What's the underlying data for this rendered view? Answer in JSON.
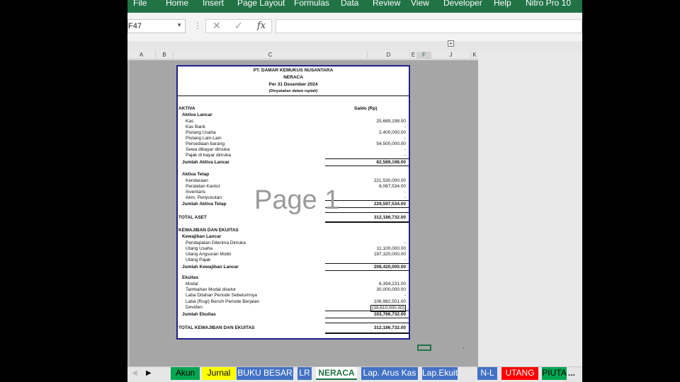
{
  "ribbon": {
    "menu": [
      "File",
      "Home",
      "Insert",
      "Page Layout",
      "Formulas",
      "Data",
      "Review",
      "View",
      "Developer",
      "Help",
      "Nitro Pro 10"
    ]
  },
  "formula_bar": {
    "name_box": "F47",
    "dots": "⋮",
    "cancel": "✕",
    "enter": "✓",
    "fx": "fx",
    "content": ""
  },
  "columns": [
    "A",
    "B",
    "C",
    "D",
    "E",
    "F",
    "J",
    "K"
  ],
  "selected_column": "F",
  "report": {
    "company": "PT. DAMAR KEMUKUS NUSANTARA",
    "title": "NERACA",
    "period": "Per 31 Desember 2024",
    "note": "(Dinyatakan dalam rupiah)",
    "aktiva_header": "AKTIVA",
    "saldo_header": "Saldo (Rp)",
    "aktiva_lancar": {
      "header": "Aktiva Lancar",
      "items": [
        {
          "label": "Kas",
          "amount": "25,689,198.00"
        },
        {
          "label": "Kas Bank",
          "amount": "-"
        },
        {
          "label": "Piutang Usaha",
          "amount": "2,400,000.00"
        },
        {
          "label": "Piutang Lain-Lain",
          "amount": "-"
        },
        {
          "label": "Persediaan barang",
          "amount": "54,500,000.00"
        },
        {
          "label": "Sewa dibayar dimuka",
          "amount": "-"
        },
        {
          "label": "Pajak di bayar dimuka",
          "amount": "-"
        }
      ],
      "total_label": "Jumlah Aktiva Lancar",
      "total": "82,589,198.00"
    },
    "aktiva_tetap": {
      "header": "Aktiva Tetap",
      "items": [
        {
          "label": "Kendaraan",
          "amount": "221,530,000.00"
        },
        {
          "label": "Peralatan Kantor",
          "amount": "8,067,534.00"
        },
        {
          "label": "Inventaris",
          "amount": "-"
        },
        {
          "label": "Akm. Penyusutan",
          "amount": "-"
        }
      ],
      "total_label": "Jumlah Aktiva Tetap",
      "total": "229,597,534.00"
    },
    "total_aset_label": "TOTAL ASET",
    "total_aset": "312,186,732.00",
    "kewajiban_ekuitas_header": "KEWAJIBAN DAN EKUITAS",
    "kewajiban_lancar": {
      "header": "Kewajiban Lancar",
      "items": [
        {
          "label": "Pendapatan Diterima Dimuka",
          "amount": "-"
        },
        {
          "label": "Utang Usaha",
          "amount": "11,100,000.00"
        },
        {
          "label": "Utang Angsuran Mobil",
          "amount": "197,320,000.00"
        },
        {
          "label": "Utang Pajak",
          "amount": "-"
        }
      ],
      "total_label": "Jumlah Kewajiban Lancar",
      "total": "208,420,000.00"
    },
    "ekuitas": {
      "header": "Ekuitas",
      "items": [
        {
          "label": "Modal",
          "amount": "6,394,231.00"
        },
        {
          "label": "Tambahan Modal disetor",
          "amount": "30,000,000.00"
        },
        {
          "label": "Laba Ditahan Periode Sebelumnya",
          "amount": "-"
        },
        {
          "label": "Laba (Rugi) Bersih Periode Berjalan",
          "amount": "106,982,501.00"
        },
        {
          "label": "Deviden",
          "amount": "(39,610,000.00)"
        }
      ],
      "total_label": "Jumlah Ekuitas",
      "total": "103,766,732.00"
    },
    "total_ke_label": "TOTAL KEWAJIBAN DAN EKUITAS",
    "total_ke": "312,186,732.00"
  },
  "watermark": "Page 1",
  "stray_text": "-",
  "sheet_tabs": [
    {
      "label": "Akun",
      "color": "#00a651",
      "text": "#000000"
    },
    {
      "label": "Jurnal",
      "color": "#ffff00",
      "text": "#000000"
    },
    {
      "label": "BUKU BESAR",
      "color": "#4472c4",
      "text": "#ffffff"
    },
    {
      "label": "LR",
      "color": "#4472c4",
      "text": "#ffffff"
    },
    {
      "label": "NERACA",
      "color": "#ffffff",
      "text": "#217346",
      "active": true
    },
    {
      "label": "Lap. Arus Kas",
      "color": "#4472c4",
      "text": "#ffffff"
    },
    {
      "label": "Lap.Ekuitas",
      "color": "#4472c4",
      "text": "#ffffff"
    },
    {
      "label": "N-L",
      "color": "#4472c4",
      "text": "#ffffff"
    },
    {
      "label": "UTANG",
      "color": "#ff0000",
      "text": "#ffffff"
    },
    {
      "label": "PIUTA",
      "color": "#00a651",
      "text": "#000000"
    }
  ],
  "tab_more": "..."
}
